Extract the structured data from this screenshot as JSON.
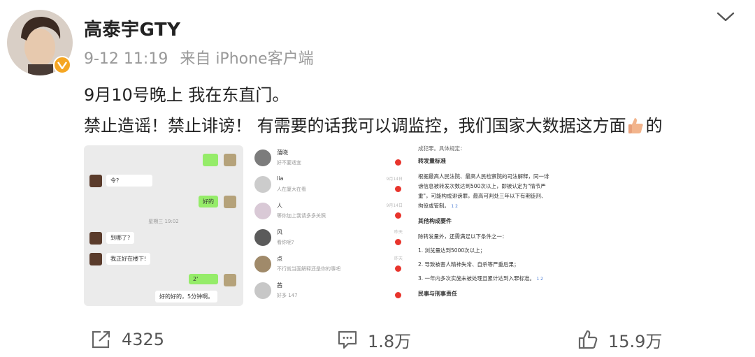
{
  "post": {
    "username": "高泰宇GTY",
    "time": "9-12 11:19",
    "source": "来自 iPhone客户端",
    "line1": "9月10号晚上 我在东直门。",
    "line2_before": "禁止造谣！禁止诽谤！ 有需要的话我可以调监控，我们国家大数据这方面",
    "line2_after": "的"
  },
  "images": {
    "chat": {
      "m1": "令?",
      "m2": "好的",
      "time": "星期三 19:02",
      "m3": "到哪了?",
      "m4": "我正好在楼下!",
      "m5": "2'",
      "m6": "好的好的，5分钟啊。"
    },
    "list": {
      "r1_name": "蒲晓",
      "r1_prev": "好不要适宜",
      "r2_name": "lia",
      "r2_prev": "人在厦大在看",
      "r3_name": "人",
      "r3_prev": "等你加上我请多多关照",
      "r4_name": "风",
      "r4_prev": "看你呢?",
      "r5_name": "点",
      "r5_prev": "不行就当面解释还是你的事吧",
      "r6_name": "茜",
      "r6_prev": "好多 147",
      "time1": "昨天",
      "time2": "9月14日"
    },
    "law": {
      "top": "成犯罪。具体规定：",
      "h1": "转发量标准",
      "p1a": "根据最高人民法院、最高人民检察院的司法解释，同一诽",
      "p1b": "谤信息被转发次数达到500次以上，即被认定为\"情节严",
      "p1c": "重\"，可能构成诽谤罪，最高可判处三年以下有期徒刑、",
      "p1d": "拘役或管制。",
      "h2": "其他构成要件",
      "p2": "除转发量外，还需满足以下条件之一：",
      "i1": "1. 浏览量达到5000次以上；",
      "i2": "2. 导致被害人精神失常、自杀等严重后果；",
      "i3": "3. 一年内多次实施未被处理且累计达到入罪标准。",
      "h3": "民事与刑事责任",
      "ref": "1 2"
    }
  },
  "actions": {
    "repost": "4325",
    "comment": "1.8万",
    "like": "15.9万"
  }
}
